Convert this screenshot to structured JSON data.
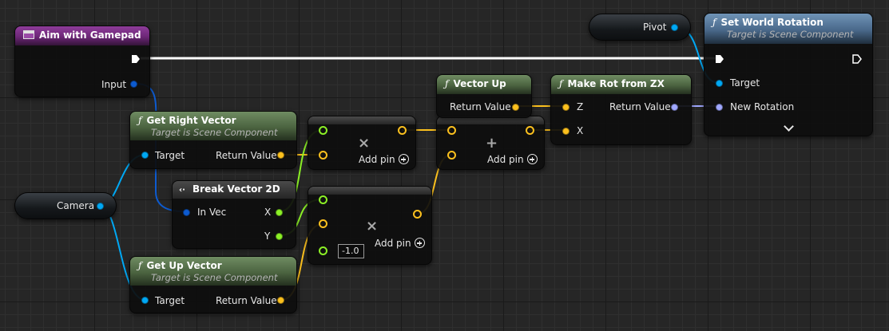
{
  "graph": {
    "aim_event": {
      "title": "Aim with Gamepad",
      "output_pin": "Input"
    },
    "get_right_vector": {
      "title": "Get Right Vector",
      "subtitle": "Target is Scene Component",
      "target_pin": "Target",
      "return_pin": "Return Value"
    },
    "get_up_vector": {
      "title": "Get Up Vector",
      "subtitle": "Target is Scene Component",
      "target_pin": "Target",
      "return_pin": "Return Value"
    },
    "break_vector_2d": {
      "title": "Break Vector 2D",
      "in_pin": "In Vec",
      "x_pin": "X",
      "y_pin": "Y"
    },
    "multiply_1": {
      "add_pin": "Add pin"
    },
    "multiply_2": {
      "add_pin": "Add pin",
      "constant": "-1.0"
    },
    "add_node": {
      "add_pin": "Add pin"
    },
    "vector_up": {
      "title": "Vector Up",
      "return_pin": "Return Value"
    },
    "make_rot": {
      "title": "Make Rot from ZX",
      "z_pin": "Z",
      "x_pin": "X",
      "return_pin": "Return Value"
    },
    "set_world_rotation": {
      "title": "Set World Rotation",
      "subtitle": "Target is Scene Component",
      "target_pin": "Target",
      "rotation_pin": "New Rotation"
    },
    "camera_var": {
      "label": "Camera"
    },
    "pivot_var": {
      "label": "Pivot"
    }
  },
  "colors": {
    "object_pin": "#00a8f4",
    "struct_pin": "#0d5bd0",
    "vector_pin": "#fbc01e",
    "float_pin": "#8cf026",
    "rotator_pin": "#a0a8ff",
    "exec_pin": "#ffffff"
  },
  "icons": {
    "event": "event-icon",
    "function": "function-icon",
    "break": "break-struct-icon",
    "multiply": "multiply-icon",
    "add": "plus-icon",
    "expand": "chevron-down-icon"
  }
}
